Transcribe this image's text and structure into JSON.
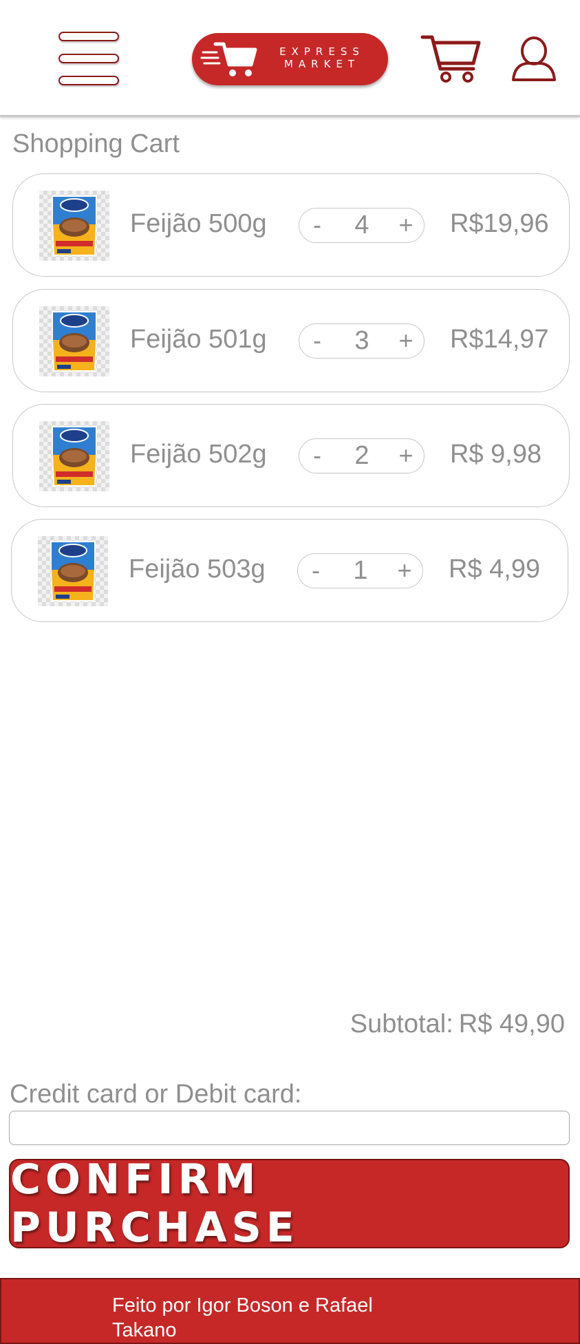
{
  "header": {
    "logo_line1": "EXPRESS",
    "logo_line2": "MARKET",
    "icons": [
      "hamburger-menu-icon",
      "shopping-cart-icon",
      "user-profile-icon"
    ]
  },
  "page": {
    "title": "Shopping Cart"
  },
  "cart": {
    "items": [
      {
        "name": "Feijão 500g",
        "quantity": "4",
        "price": "R$19,96",
        "minus": "-",
        "plus": "+"
      },
      {
        "name": "Feijão 501g",
        "quantity": "3",
        "price": "R$14,97",
        "minus": "-",
        "plus": "+"
      },
      {
        "name": "Feijão 502g",
        "quantity": "2",
        "price": "R$ 9,98",
        "minus": "-",
        "plus": "+"
      },
      {
        "name": "Feijão 503g",
        "quantity": "1",
        "price": "R$ 4,99",
        "minus": "-",
        "plus": "+"
      }
    ],
    "subtotal_label": "Subtotal:",
    "subtotal_value": "R$ 49,90"
  },
  "payment": {
    "card_label": "Credit card or Debit card:",
    "card_value": "",
    "card_placeholder": ""
  },
  "actions": {
    "confirm_label": "CONFIRM PURCHASE"
  },
  "footer": {
    "credits": "Feito por Igor Boson e Rafael Takano"
  },
  "colors": {
    "brand_red": "#c62828",
    "dark_red": "#8b1a1a",
    "text_gray": "#8f8f8f",
    "border_gray": "#c6c6c6"
  }
}
